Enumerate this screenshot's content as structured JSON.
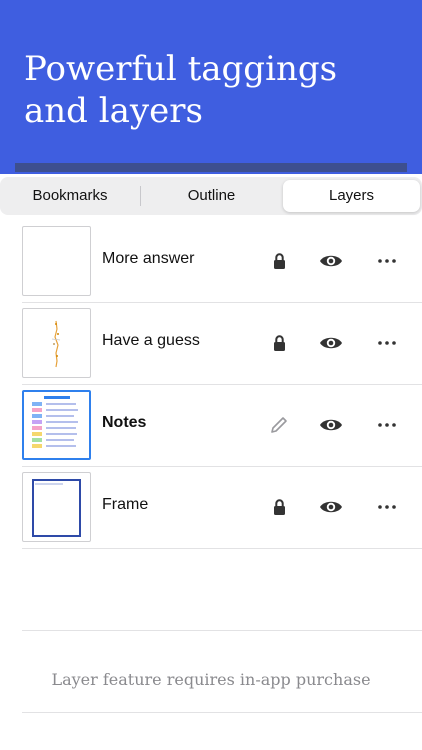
{
  "header": {
    "title": "Powerful taggings and layers"
  },
  "tabs": [
    {
      "label": "Bookmarks",
      "selected": false
    },
    {
      "label": "Outline",
      "selected": false
    },
    {
      "label": "Layers",
      "selected": true
    }
  ],
  "layers": [
    {
      "name": "More answer",
      "status_icon": "lock-icon",
      "visibility_icon": "eye-icon",
      "selected": false
    },
    {
      "name": "Have a guess",
      "status_icon": "lock-icon",
      "visibility_icon": "eye-icon",
      "selected": false
    },
    {
      "name": "Notes",
      "status_icon": "pencil-icon",
      "visibility_icon": "eye-icon",
      "selected": true
    },
    {
      "name": "Frame",
      "status_icon": "lock-icon",
      "visibility_icon": "eye-icon",
      "selected": false
    }
  ],
  "footer": {
    "purchase_notice": "Layer feature requires in-app purchase"
  },
  "colors": {
    "header_bg": "#3f5ee0",
    "accent": "#2f80ed"
  }
}
